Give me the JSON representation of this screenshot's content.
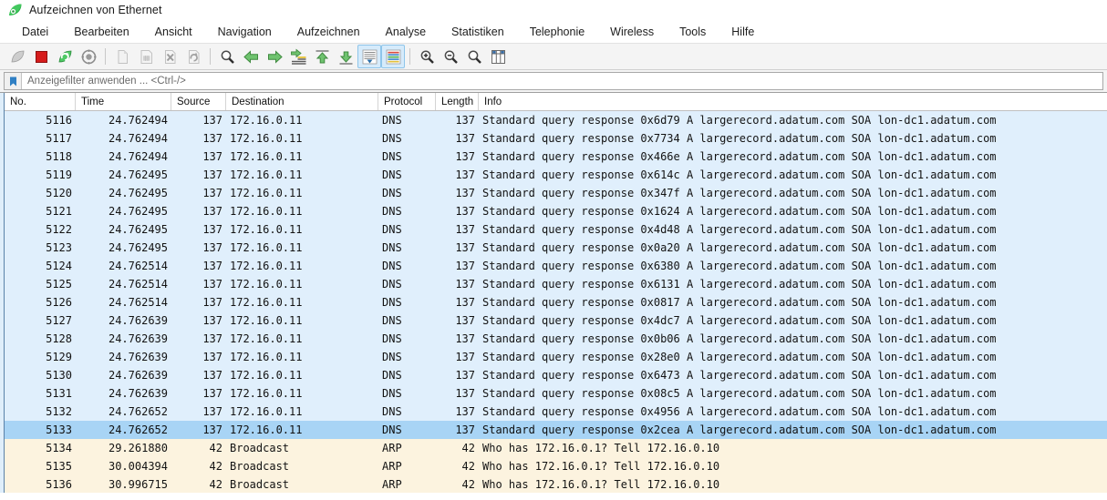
{
  "window": {
    "title": "Aufzeichnen von Ethernet",
    "app_icon": "wireshark-fin-icon"
  },
  "menu": {
    "items": [
      {
        "label": "Datei"
      },
      {
        "label": "Bearbeiten"
      },
      {
        "label": "Ansicht"
      },
      {
        "label": "Navigation"
      },
      {
        "label": "Aufzeichnen"
      },
      {
        "label": "Analyse"
      },
      {
        "label": "Statistiken"
      },
      {
        "label": "Telephonie"
      },
      {
        "label": "Wireless"
      },
      {
        "label": "Tools"
      },
      {
        "label": "Hilfe"
      }
    ]
  },
  "toolbar": {
    "buttons": [
      {
        "name": "start-capture-icon",
        "enabled": true,
        "active": false
      },
      {
        "name": "stop-capture-icon",
        "enabled": true,
        "active": false
      },
      {
        "name": "restart-capture-icon",
        "enabled": true,
        "active": false
      },
      {
        "name": "capture-options-icon",
        "enabled": true,
        "active": false
      },
      {
        "name": "separator",
        "enabled": true,
        "active": false
      },
      {
        "name": "open-file-icon",
        "enabled": false,
        "active": false
      },
      {
        "name": "save-file-icon",
        "enabled": false,
        "active": false
      },
      {
        "name": "close-file-icon",
        "enabled": false,
        "active": false
      },
      {
        "name": "reload-file-icon",
        "enabled": false,
        "active": false
      },
      {
        "name": "separator",
        "enabled": true,
        "active": false
      },
      {
        "name": "find-packet-icon",
        "enabled": true,
        "active": false
      },
      {
        "name": "go-back-icon",
        "enabled": true,
        "active": false
      },
      {
        "name": "go-forward-icon",
        "enabled": true,
        "active": false
      },
      {
        "name": "go-to-packet-icon",
        "enabled": true,
        "active": false
      },
      {
        "name": "go-to-first-packet-icon",
        "enabled": true,
        "active": false
      },
      {
        "name": "go-to-last-packet-icon",
        "enabled": true,
        "active": false
      },
      {
        "name": "auto-scroll-icon",
        "enabled": true,
        "active": true
      },
      {
        "name": "colorize-packets-icon",
        "enabled": true,
        "active": true
      },
      {
        "name": "separator",
        "enabled": true,
        "active": false
      },
      {
        "name": "zoom-in-icon",
        "enabled": true,
        "active": false
      },
      {
        "name": "zoom-out-icon",
        "enabled": true,
        "active": false
      },
      {
        "name": "zoom-reset-icon",
        "enabled": true,
        "active": false
      },
      {
        "name": "resize-columns-icon",
        "enabled": true,
        "active": false
      }
    ]
  },
  "filter": {
    "placeholder": "Anzeigefilter anwenden ... <Ctrl-/>",
    "value": "",
    "bookmark_icon": "bookmark-icon"
  },
  "packet_list": {
    "columns": [
      {
        "label": "No."
      },
      {
        "label": "Time"
      },
      {
        "label": "Source"
      },
      {
        "label": "Destination"
      },
      {
        "label": "Protocol"
      },
      {
        "label": "Length"
      },
      {
        "label": "Info"
      }
    ],
    "selected_no": "5133",
    "rows": [
      {
        "no": "5116",
        "time": "24.762494",
        "source": "137",
        "destination": "172.16.0.11",
        "protocol": "DNS",
        "length": "137",
        "info": "Standard query response 0x6d79 A largerecord.adatum.com SOA lon-dc1.adatum.com",
        "kind": "dns"
      },
      {
        "no": "5117",
        "time": "24.762494",
        "source": "137",
        "destination": "172.16.0.11",
        "protocol": "DNS",
        "length": "137",
        "info": "Standard query response 0x7734 A largerecord.adatum.com SOA lon-dc1.adatum.com",
        "kind": "dns"
      },
      {
        "no": "5118",
        "time": "24.762494",
        "source": "137",
        "destination": "172.16.0.11",
        "protocol": "DNS",
        "length": "137",
        "info": "Standard query response 0x466e A largerecord.adatum.com SOA lon-dc1.adatum.com",
        "kind": "dns"
      },
      {
        "no": "5119",
        "time": "24.762495",
        "source": "137",
        "destination": "172.16.0.11",
        "protocol": "DNS",
        "length": "137",
        "info": "Standard query response 0x614c A largerecord.adatum.com SOA lon-dc1.adatum.com",
        "kind": "dns"
      },
      {
        "no": "5120",
        "time": "24.762495",
        "source": "137",
        "destination": "172.16.0.11",
        "protocol": "DNS",
        "length": "137",
        "info": "Standard query response 0x347f A largerecord.adatum.com SOA lon-dc1.adatum.com",
        "kind": "dns"
      },
      {
        "no": "5121",
        "time": "24.762495",
        "source": "137",
        "destination": "172.16.0.11",
        "protocol": "DNS",
        "length": "137",
        "info": "Standard query response 0x1624 A largerecord.adatum.com SOA lon-dc1.adatum.com",
        "kind": "dns"
      },
      {
        "no": "5122",
        "time": "24.762495",
        "source": "137",
        "destination": "172.16.0.11",
        "protocol": "DNS",
        "length": "137",
        "info": "Standard query response 0x4d48 A largerecord.adatum.com SOA lon-dc1.adatum.com",
        "kind": "dns"
      },
      {
        "no": "5123",
        "time": "24.762495",
        "source": "137",
        "destination": "172.16.0.11",
        "protocol": "DNS",
        "length": "137",
        "info": "Standard query response 0x0a20 A largerecord.adatum.com SOA lon-dc1.adatum.com",
        "kind": "dns"
      },
      {
        "no": "5124",
        "time": "24.762514",
        "source": "137",
        "destination": "172.16.0.11",
        "protocol": "DNS",
        "length": "137",
        "info": "Standard query response 0x6380 A largerecord.adatum.com SOA lon-dc1.adatum.com",
        "kind": "dns"
      },
      {
        "no": "5125",
        "time": "24.762514",
        "source": "137",
        "destination": "172.16.0.11",
        "protocol": "DNS",
        "length": "137",
        "info": "Standard query response 0x6131 A largerecord.adatum.com SOA lon-dc1.adatum.com",
        "kind": "dns"
      },
      {
        "no": "5126",
        "time": "24.762514",
        "source": "137",
        "destination": "172.16.0.11",
        "protocol": "DNS",
        "length": "137",
        "info": "Standard query response 0x0817 A largerecord.adatum.com SOA lon-dc1.adatum.com",
        "kind": "dns"
      },
      {
        "no": "5127",
        "time": "24.762639",
        "source": "137",
        "destination": "172.16.0.11",
        "protocol": "DNS",
        "length": "137",
        "info": "Standard query response 0x4dc7 A largerecord.adatum.com SOA lon-dc1.adatum.com",
        "kind": "dns"
      },
      {
        "no": "5128",
        "time": "24.762639",
        "source": "137",
        "destination": "172.16.0.11",
        "protocol": "DNS",
        "length": "137",
        "info": "Standard query response 0x0b06 A largerecord.adatum.com SOA lon-dc1.adatum.com",
        "kind": "dns"
      },
      {
        "no": "5129",
        "time": "24.762639",
        "source": "137",
        "destination": "172.16.0.11",
        "protocol": "DNS",
        "length": "137",
        "info": "Standard query response 0x28e0 A largerecord.adatum.com SOA lon-dc1.adatum.com",
        "kind": "dns"
      },
      {
        "no": "5130",
        "time": "24.762639",
        "source": "137",
        "destination": "172.16.0.11",
        "protocol": "DNS",
        "length": "137",
        "info": "Standard query response 0x6473 A largerecord.adatum.com SOA lon-dc1.adatum.com",
        "kind": "dns"
      },
      {
        "no": "5131",
        "time": "24.762639",
        "source": "137",
        "destination": "172.16.0.11",
        "protocol": "DNS",
        "length": "137",
        "info": "Standard query response 0x08c5 A largerecord.adatum.com SOA lon-dc1.adatum.com",
        "kind": "dns"
      },
      {
        "no": "5132",
        "time": "24.762652",
        "source": "137",
        "destination": "172.16.0.11",
        "protocol": "DNS",
        "length": "137",
        "info": "Standard query response 0x4956 A largerecord.adatum.com SOA lon-dc1.adatum.com",
        "kind": "dns"
      },
      {
        "no": "5133",
        "time": "24.762652",
        "source": "137",
        "destination": "172.16.0.11",
        "protocol": "DNS",
        "length": "137",
        "info": "Standard query response 0x2cea A largerecord.adatum.com SOA lon-dc1.adatum.com",
        "kind": "selected"
      },
      {
        "no": "5134",
        "time": "29.261880",
        "source": "42",
        "destination": "Broadcast",
        "protocol": "ARP",
        "length": "42",
        "info": "Who has 172.16.0.1? Tell 172.16.0.10",
        "kind": "arp"
      },
      {
        "no": "5135",
        "time": "30.004394",
        "source": "42",
        "destination": "Broadcast",
        "protocol": "ARP",
        "length": "42",
        "info": "Who has 172.16.0.1? Tell 172.16.0.10",
        "kind": "arp"
      },
      {
        "no": "5136",
        "time": "30.996715",
        "source": "42",
        "destination": "Broadcast",
        "protocol": "ARP",
        "length": "42",
        "info": "Who has 172.16.0.1? Tell 172.16.0.10",
        "kind": "arp"
      }
    ]
  },
  "colors": {
    "dns_row": "#e0effc",
    "arp_row": "#fcf3df",
    "selected_row": "#a8d4f5",
    "toolbar_bg": "#f4f4f4",
    "accent_green": "#38b44a",
    "stop_red": "#d61c1c"
  }
}
